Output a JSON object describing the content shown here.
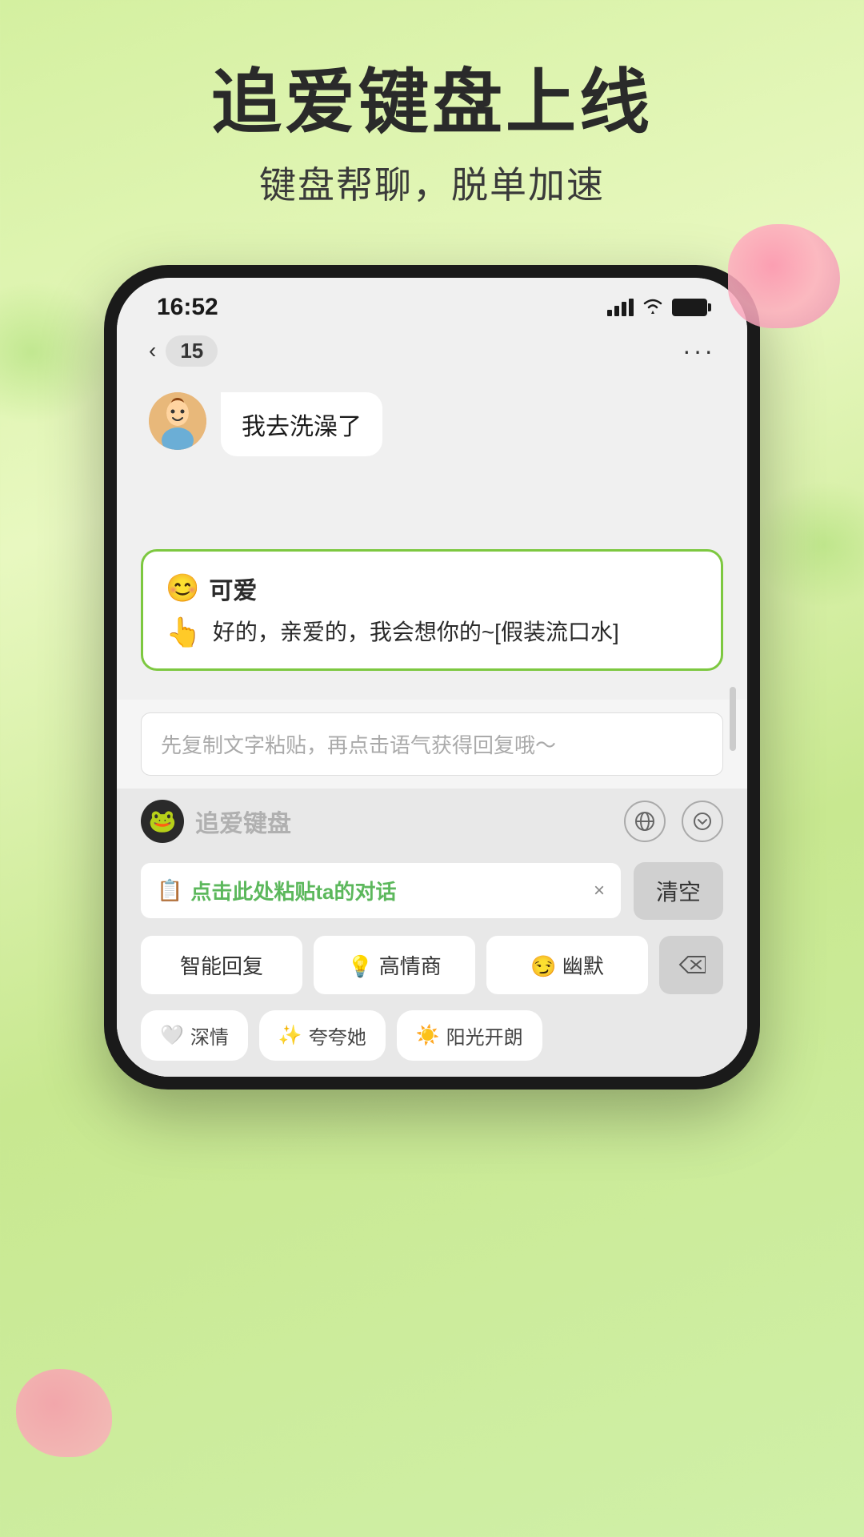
{
  "page": {
    "background_color": "#c8e890",
    "main_title": "追爱键盘上线",
    "sub_title": "键盘帮聊，脱单加速"
  },
  "status_bar": {
    "time": "16:52",
    "signal_label": "signal",
    "wifi_label": "wifi",
    "battery_label": "battery"
  },
  "nav": {
    "back_label": "‹",
    "badge": "15",
    "more_label": "···"
  },
  "chat": {
    "received_message": "我去洗澡了",
    "avatar_emoji": "🧒"
  },
  "ai_box": {
    "emoji": "😊",
    "label": "可爱",
    "hand_emoji": "👆",
    "suggestion_text": "好的，亲爱的，我会想你的~[假装流口水]"
  },
  "keyboard": {
    "input_placeholder": "先复制文字粘贴，再点击语气获得回复哦～",
    "logo_emoji": "🐸",
    "keyboard_name": "追爱键盘",
    "globe_icon": "⊕",
    "down_icon": "⌄",
    "paste_icon": "📋",
    "paste_label": "点击此处粘贴ta的对话",
    "paste_close": "×",
    "clear_label": "清空",
    "quick_buttons": [
      {
        "label": "智能回复",
        "emoji": ""
      },
      {
        "label": "高情商",
        "emoji": "💡"
      },
      {
        "label": "幽默",
        "emoji": "😏"
      }
    ],
    "delete_icon": "⌫",
    "tag_chips": [
      {
        "emoji": "🤍",
        "label": "深情"
      },
      {
        "emoji": "🌟",
        "label": "夸夸她"
      },
      {
        "emoji": "☀️",
        "label": "阳光开朗"
      }
    ]
  }
}
